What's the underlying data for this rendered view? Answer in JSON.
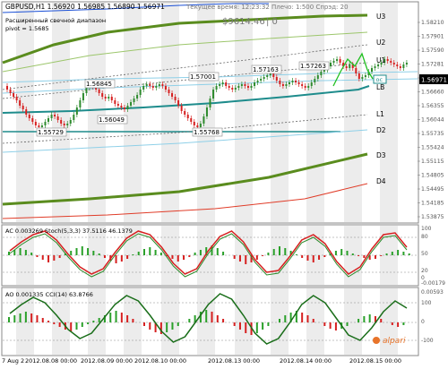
{
  "header": {
    "symbol_line": "GBPUSD,H1  1.56920 1.56985 1.56890 1.56971",
    "channel_label": "Расширенный свечной диапазон",
    "pivot_label": "pivot = 1.5685",
    "server_time": "Текущее время: 12:23:32 Плечо: 1:500 Спрэд: 20",
    "equity": "$9614.46",
    "equity_suffix": "| 0"
  },
  "price_axis": [
    {
      "label": "1.58210"
    },
    {
      "label": "1.57901"
    },
    {
      "label": "1.57590"
    },
    {
      "label": "1.57281"
    },
    {
      "label": "1.56971"
    },
    {
      "label": "1.56660"
    },
    {
      "label": "1.56355"
    },
    {
      "label": "1.56044"
    },
    {
      "label": "1.55735"
    },
    {
      "label": "1.55424"
    },
    {
      "label": "1.55115"
    },
    {
      "label": "1.54805"
    },
    {
      "label": "1.54495"
    },
    {
      "label": "1.54185"
    },
    {
      "label": "1.53875"
    }
  ],
  "current_price": "1.56971",
  "level_labels": [
    "U3",
    "U2",
    "U1",
    "LB",
    "L1",
    "D2",
    "D3",
    "D4"
  ],
  "price_annotations": [
    "1.56845",
    "1.57001",
    "1.57163",
    "1.57263",
    "1.55729",
    "1.56049",
    "1.55768"
  ],
  "oc_badge": "oc",
  "ac_panel": {
    "label": "AC 0.003269  Stoch(5,3,3) 37.5116 46.1379",
    "ticks": [
      "100",
      "80",
      "50",
      "20",
      "0",
      "-0.00179"
    ]
  },
  "ao_panel": {
    "label": "AO 0.001335  CCI(14) 63.8766",
    "ticks": [
      "0.00593",
      "100",
      "0",
      "-100"
    ]
  },
  "time_axis": [
    "7 Aug 2012",
    "2012.08.08 00:00",
    "2012.08.09 00:00",
    "2012.08.10 00:00",
    "2012.08.13 00:00",
    "2012.08.14 00:00",
    "2012.08.15 00:00"
  ],
  "brand": "alpari",
  "colors": {
    "grid_stripe": "#ececec",
    "candle_up": "#2e8b2e",
    "candle_down": "#d62020",
    "teal": "#1e8c8c",
    "green_band": "#5a8c1e",
    "red_band": "#e03c28",
    "blue_line": "#1a4fd6"
  }
}
